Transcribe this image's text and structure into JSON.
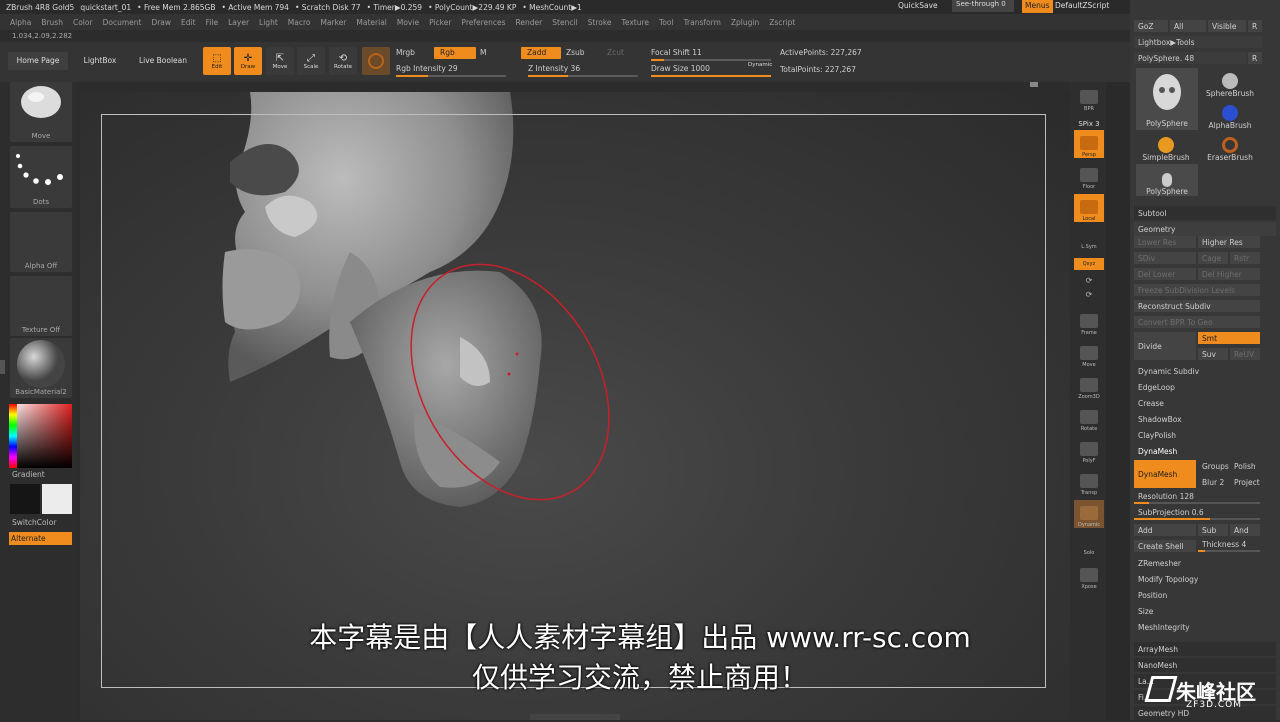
{
  "titlebar": {
    "app": "ZBrush 4R8 Gold5",
    "document": "quickstart_01",
    "free_mem": "• Free Mem 2.865GB",
    "active_mem": "• Active Mem 794",
    "scratch": "• Scratch Disk 77",
    "timer": "• Timer▶0.259",
    "polycount": "• PolyCount▶229.49 KP",
    "meshcount": "• MeshCount▶1",
    "quicksave": "QuickSave",
    "seethrough": "See-through  0",
    "menus": "Menus",
    "script": "DefaultZScript"
  },
  "menubar": [
    "Alpha",
    "Brush",
    "Color",
    "Document",
    "Draw",
    "Edit",
    "File",
    "Layer",
    "Light",
    "Macro",
    "Marker",
    "Material",
    "Movie",
    "Picker",
    "Preferences",
    "Render",
    "Stencil",
    "Stroke",
    "Texture",
    "Tool",
    "Transform",
    "Zplugin",
    "Zscript"
  ],
  "coords": "1.034,2.09,2.282",
  "toolbar": {
    "home": "Home Page",
    "lightbox": "LightBox",
    "liveboolean": "Live Boolean",
    "edit": "Edit",
    "draw": "Draw",
    "move": "Move",
    "scale": "Scale",
    "rotate": "Rotate",
    "mrgb": "Mrgb",
    "rgb": "Rgb",
    "m": "M",
    "rgb_intensity": "Rgb Intensity 29",
    "zadd": "Zadd",
    "zsub": "Zsub",
    "zcut": "Zcut",
    "z_intensity": "Z Intensity 36",
    "focal_shift": "Focal Shift 11",
    "draw_size": "Draw Size 1000",
    "dynamic": "Dynamic",
    "active_points": "ActivePoints: 227,267",
    "total_points": "TotalPoints: 227,267"
  },
  "levels": {
    "rgb_intensity": 0.29,
    "z_intensity": 0.36,
    "focal_shift": 0.11,
    "draw_size": 1.0
  },
  "left": {
    "move": "Move",
    "dots": "Dots",
    "alpha": "Alpha Off",
    "texture": "Texture Off",
    "material": "BasicMaterial2",
    "gradient": "Gradient",
    "switchcolor": "SwitchColor",
    "alternate": "Alternate"
  },
  "rightstrip": [
    "BPR",
    "SPix 3",
    "Persp",
    "Floor",
    "Local",
    "L.Sym",
    "Qxyz",
    "",
    "",
    "Frame",
    "Move",
    "Zoom3D",
    "Rotate",
    "PolyF",
    "Transp",
    "Dynamic",
    "Solo",
    "Xpose"
  ],
  "panel": {
    "goz": "GoZ",
    "all": "All",
    "visible": "Visible",
    "r": "R",
    "lightbox_tools": "Lightbox▶Tools",
    "polysphere48": "PolySphere. 48",
    "r2": "R",
    "tools": [
      "PolySphere",
      "SphereBrush",
      "AlphaBrush",
      "SimpleBrush",
      "EraserBrush",
      "PolySphere"
    ],
    "subtool": "Subtool",
    "geometry": "Geometry",
    "lower_res": "Lower Res",
    "higher_res": "Higher Res",
    "sdiv": "SDiv",
    "cage": "Cage",
    "rstr": "Rstr",
    "del_lower": "Del Lower",
    "del_higher": "Del Higher",
    "freeze": "Freeze SubDivision Levels",
    "reconstruct": "Reconstruct Subdiv",
    "convert_bpr": "Convert BPR To Geo",
    "divide": "Divide",
    "smt": "Smt",
    "suv": "Suv",
    "reuv": "ReUV",
    "dynamic_subdiv": "Dynamic Subdiv",
    "edgeloop": "EdgeLoop",
    "crease": "Crease",
    "shadowbox": "ShadowBox",
    "claypolish": "ClayPolish",
    "dynamesh_head": "DynaMesh",
    "dynamesh_btn": "DynaMesh",
    "groups": "Groups",
    "polish": "Polish",
    "blur": "Blur 2",
    "project": "Project",
    "resolution": "Resolution 128",
    "subprojection": "SubProjection 0.6",
    "add": "Add",
    "sub": "Sub",
    "and": "And",
    "create_shell": "Create Shell",
    "thickness": "Thickness 4",
    "zremesher": "ZRemesher",
    "modify_topology": "Modify Topology",
    "position": "Position",
    "size": "Size",
    "meshintegrity": "MeshIntegrity",
    "arraymesh": "ArrayMesh",
    "nanomesh": "NanoMesh",
    "layers": "La...",
    "fibermesh": "Fi...",
    "geometry_hd": "Geometry HD"
  },
  "subtitle": {
    "line1": "本字幕是由【人人素材字幕组】出品 www.rr-sc.com",
    "line2": "仅供学习交流，禁止商用！"
  },
  "watermark": {
    "name": "朱峰社区",
    "url": "ZF3D.COM"
  },
  "colors": {
    "accent": "#f08c1e",
    "brush_ring": "#c8202a"
  }
}
